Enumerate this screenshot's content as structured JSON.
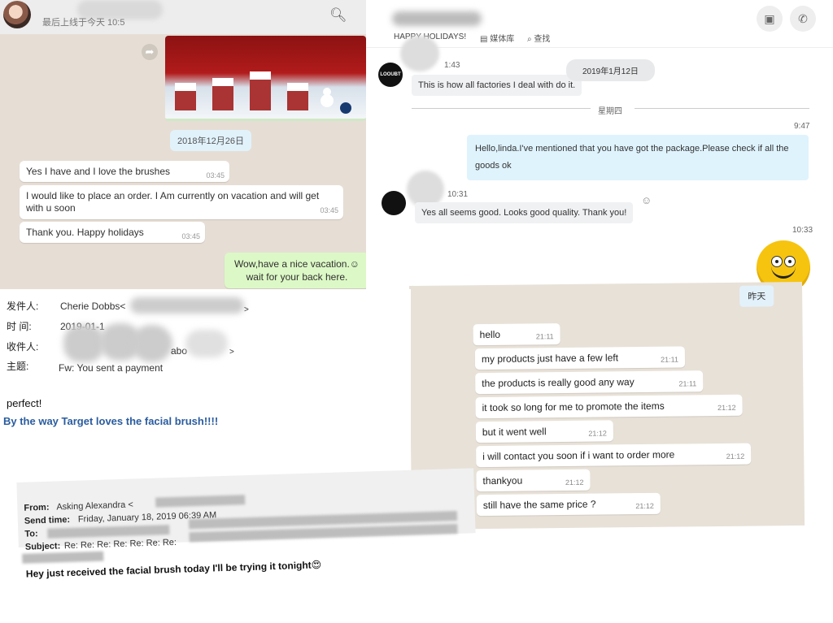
{
  "wa1": {
    "status": "最后上线于今天 10:5",
    "date": "2018年12月26日",
    "messages": [
      {
        "text": "Yes I have and I love the brushes",
        "time": "03:45"
      },
      {
        "text": "I would like to place an order. I Am currently on vacation and will get with u soon",
        "time": "03:45"
      },
      {
        "text": "Thank you. Happy holidays",
        "time": "03:45"
      }
    ],
    "reply_line1": "Wow,have a nice vacation.☺",
    "reply_line2": "wait for your back here."
  },
  "chat2": {
    "mood": "HAPPY HOLIDAYS!",
    "media": "媒体库",
    "find": "查找",
    "msg1_time": "1:43",
    "msg1": "This is how all factories I deal with do it.",
    "date_pill": "2019年1月12日",
    "day": "星期四",
    "out_time": "9:47",
    "out_line1": "Hello,linda.I've mentioned that you have got the package.Please check if all the",
    "out_line2": "goods ok",
    "in2_time": "10:31",
    "in2": "Yes all seems good. Looks good quality. Thank you!",
    "time3": "10:33",
    "logo_text": "LOOUBT"
  },
  "wa2": {
    "date": "昨天",
    "messages": [
      {
        "text": "hello",
        "time": "21:11"
      },
      {
        "text": "my products just have a few left",
        "time": "21:11"
      },
      {
        "text": "the products is really good any way",
        "time": "21:11"
      },
      {
        "text": "it took so long for me to promote the items",
        "time": "21:12"
      },
      {
        "text": "but it went well",
        "time": "21:12"
      },
      {
        "text": "i will contact you soon if i want to order more",
        "time": "21:12"
      },
      {
        "text": "thankyou",
        "time": "21:12"
      },
      {
        "text": "still have the same price ?",
        "time": "21:12"
      }
    ]
  },
  "mail1": {
    "from_label": "发件人:",
    "from_value": "Cherie Dobbs<",
    "time_label": "时 间:",
    "time_value": "2019-01-1",
    "to_label": "收件人:",
    "to_value": "abo",
    "subject_label": "主题:",
    "subject_value": "Fw: You sent a payment",
    "body1": "perfect!",
    "body2": "By the way Target loves the facial brush!!!!"
  },
  "mail2": {
    "from_label": "From:",
    "from_value": "Asking Alexandra <",
    "sent_label": "Send time:",
    "sent_value": "Friday, January 18, 2019 06:39 AM",
    "to_label": "To:",
    "subject_label": "Subject:",
    "subject_value": "Re: Re: Re: Re: Re: Re: Re:",
    "body": "Hey just received the facial brush today I'll be trying it tonight😍"
  },
  "colors": {
    "wa_bg": "#e6ded5",
    "wa_out": "#dcf8c6",
    "skype_out": "#dff3fd",
    "email_blue": "#2a5c9f"
  }
}
